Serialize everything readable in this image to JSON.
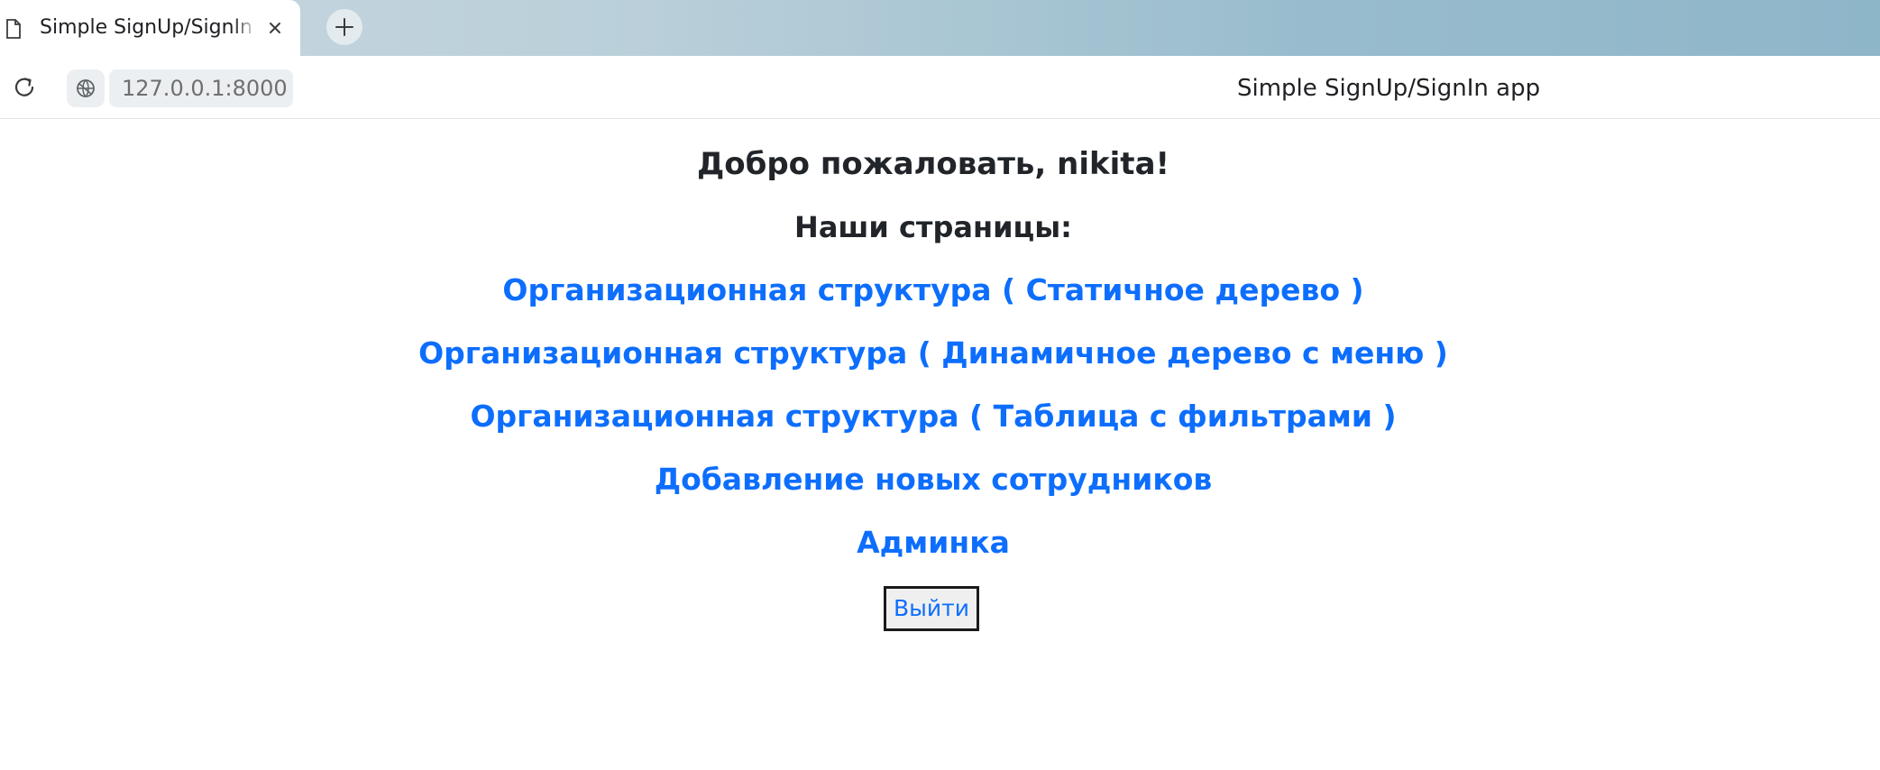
{
  "browser": {
    "tab_title": "Simple SignUp/SignIn app",
    "url": "127.0.0.1:8000",
    "page_title": "Simple SignUp/SignIn app"
  },
  "page": {
    "welcome": "Добро пожаловать, nikita!",
    "pages_heading": "Наши страницы:",
    "links": [
      "Организационная структура ( Статичное дерево )",
      "Организационная структура ( Динамичное дерево с меню )",
      "Организационная структура ( Таблица с фильтрами )",
      "Добавление новых сотрудников",
      "Админка"
    ],
    "logout_label": "Выйти"
  },
  "colors": {
    "link": "#0d6efd",
    "heading": "#212529",
    "tabbar_gradient_end": "#8eb6c9"
  }
}
